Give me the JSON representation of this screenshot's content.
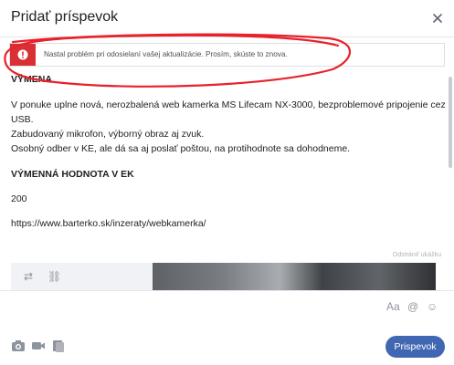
{
  "dialog": {
    "title": "Pridať príspevok"
  },
  "error": {
    "message": "Nastal problém pri odosielaní vašej aktualizácie. Prosím, skúste to znova."
  },
  "post": {
    "heading_exchange": "VÝMENA",
    "line1": "V ponuke uplne nová, nerozbalená web kamerka MS Lifecam NX-3000, bezproblemové pripojenie cez",
    "line2": "USB.",
    "line3": "Zabudovaný mikrofon, výborný obraz aj zvuk.",
    "line4": "Osobný odber v KE, ale dá sa aj poslať poštou, na protihodnote sa dohodneme.",
    "heading_value": "VÝMENNÁ HODNOTA V EK",
    "value": "200",
    "link": "https://www.barterko.sk/inzeraty/webkamerka/"
  },
  "preview": {
    "remove_label": "Odstrániť ukážku"
  },
  "composer": {
    "font_label": "Aa"
  },
  "footer": {
    "post_button": "Prispevok"
  },
  "colors": {
    "error": "#d93036",
    "accent": "#4267b2",
    "scribble": "#e8212a"
  },
  "icons": [
    "close-icon",
    "exclamation-icon",
    "swap-icon",
    "no-link-icon",
    "at-icon",
    "emoji-icon",
    "camera-icon",
    "video-icon",
    "album-icon"
  ]
}
